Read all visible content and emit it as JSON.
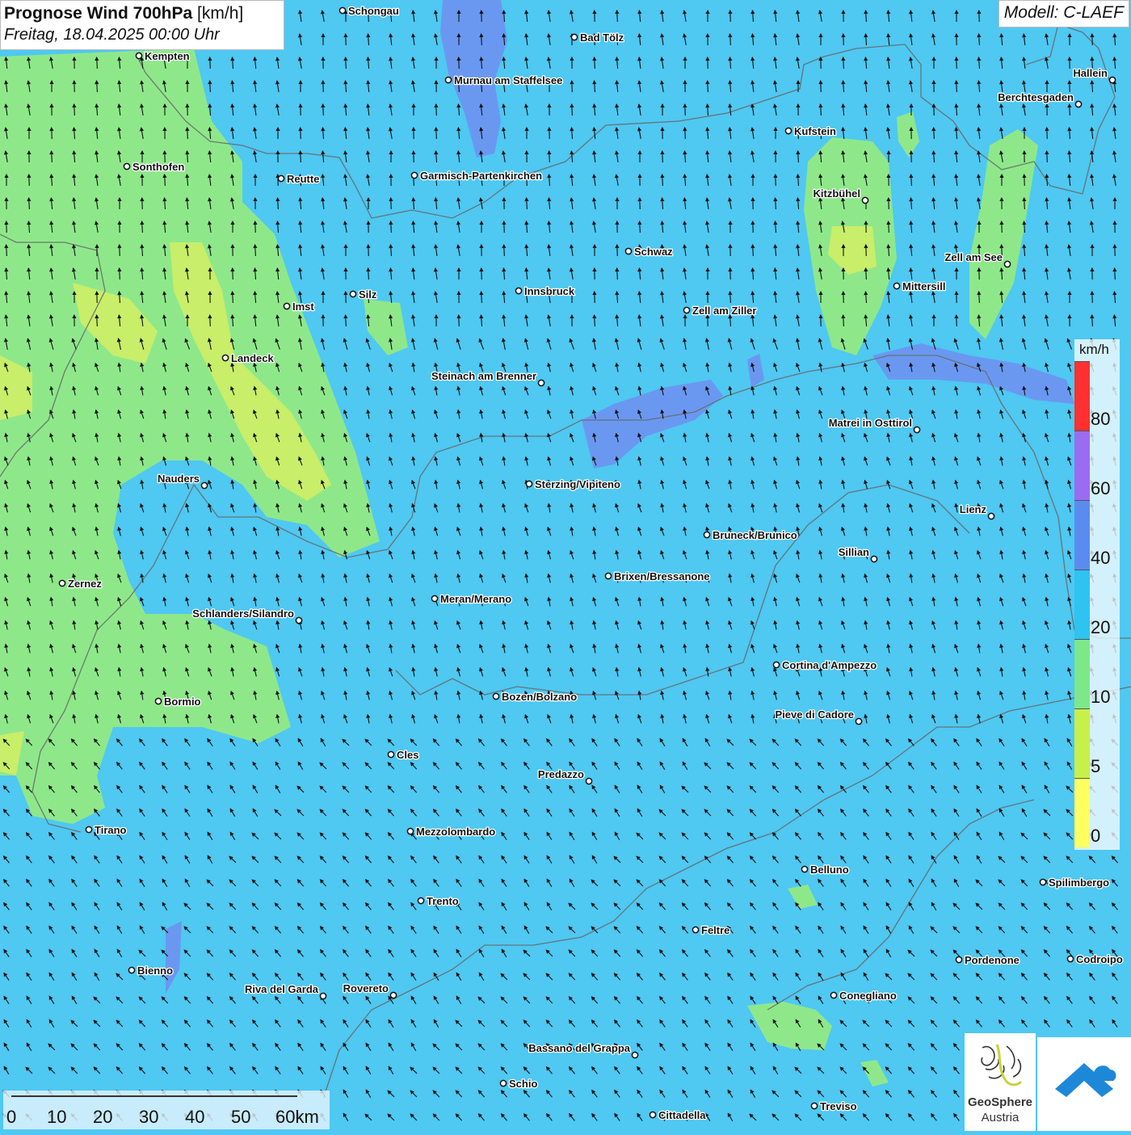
{
  "header": {
    "title": "Prognose Wind 700hPa",
    "title_unit": "[km/h]",
    "subtitle": "Freitag, 18.04.2025 00:00 Uhr",
    "model": "Modell: C-LAEF"
  },
  "legend": {
    "unit": "km/h",
    "labels": [
      "80",
      "60",
      "40",
      "20",
      "10",
      "5",
      "0"
    ],
    "colors": [
      "#ff3030",
      "#7d55e8",
      "#9b6cf0",
      "#5a8cf0",
      "#2ec3f0",
      "#7de88a",
      "#c8f04a",
      "#ffff60"
    ]
  },
  "scale_bar": {
    "labels": [
      "0",
      "10",
      "20",
      "30",
      "40",
      "50",
      "60km"
    ]
  },
  "logos": {
    "geosphere_line1": "GeoSphere",
    "geosphere_line2": "Austria"
  },
  "cities": [
    {
      "name": "Schongau",
      "side": "right"
    },
    {
      "name": "Bad Tölz",
      "side": "right"
    },
    {
      "name": "Kempten",
      "side": "right"
    },
    {
      "name": "Murnau am Staffelsee",
      "side": "right"
    },
    {
      "name": "Hallein",
      "side": "left"
    },
    {
      "name": "Berchtesgaden",
      "side": "left"
    },
    {
      "name": "Kufstein",
      "side": "right"
    },
    {
      "name": "Sonthofen",
      "side": "right"
    },
    {
      "name": "Reutte",
      "side": "right"
    },
    {
      "name": "Garmisch-Partenkirchen",
      "side": "right"
    },
    {
      "name": "Kitzbühel",
      "side": "left"
    },
    {
      "name": "Schwaz",
      "side": "right"
    },
    {
      "name": "Zell am See",
      "side": "left"
    },
    {
      "name": "Silz",
      "side": "right"
    },
    {
      "name": "Innsbruck",
      "side": "right"
    },
    {
      "name": "Mittersill",
      "side": "right"
    },
    {
      "name": "Imst",
      "side": "right"
    },
    {
      "name": "Zell am Ziller",
      "side": "right"
    },
    {
      "name": "Landeck",
      "side": "right"
    },
    {
      "name": "Steinach am Brenner",
      "side": "left"
    },
    {
      "name": "Matrei in Osttirol",
      "side": "left"
    },
    {
      "name": "Nauders",
      "side": "left"
    },
    {
      "name": "Sterzing/Vipiteno",
      "side": "right"
    },
    {
      "name": "Lienz",
      "side": "left"
    },
    {
      "name": "Bruneck/Brunico",
      "side": "right"
    },
    {
      "name": "Sillian",
      "side": "left"
    },
    {
      "name": "Brixen/Bressanone",
      "side": "right"
    },
    {
      "name": "Zernez",
      "side": "right"
    },
    {
      "name": "Meran/Merano",
      "side": "right"
    },
    {
      "name": "Schlanders/Silandro",
      "side": "left"
    },
    {
      "name": "Cortina d'Ampezzo",
      "side": "right"
    },
    {
      "name": "Bozen/Bolzano",
      "side": "right"
    },
    {
      "name": "Bormio",
      "side": "right"
    },
    {
      "name": "Pieve di Cadore",
      "side": "left"
    },
    {
      "name": "Cles",
      "side": "right"
    },
    {
      "name": "Predazzo",
      "side": "left"
    },
    {
      "name": "Tirano",
      "side": "right"
    },
    {
      "name": "Mezzolombardo",
      "side": "right"
    },
    {
      "name": "Belluno",
      "side": "right"
    },
    {
      "name": "Spilimbergo",
      "side": "right"
    },
    {
      "name": "Trento",
      "side": "right"
    },
    {
      "name": "Feltre",
      "side": "right"
    },
    {
      "name": "Pordenone",
      "side": "right"
    },
    {
      "name": "Codroipo",
      "side": "right"
    },
    {
      "name": "Bienno",
      "side": "right"
    },
    {
      "name": "Riva del Garda",
      "side": "left"
    },
    {
      "name": "Rovereto",
      "side": "left"
    },
    {
      "name": "Conegliano",
      "side": "right"
    },
    {
      "name": "Bassano del Grappa",
      "side": "left"
    },
    {
      "name": "Schio",
      "side": "right"
    },
    {
      "name": "Treviso",
      "side": "right"
    },
    {
      "name": "Cittadella",
      "side": "right"
    }
  ]
}
